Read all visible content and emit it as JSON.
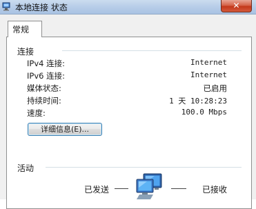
{
  "window": {
    "title": "本地连接 状态",
    "close_glyph": "✕"
  },
  "tabs": [
    {
      "label": "常规"
    }
  ],
  "connection": {
    "heading": "连接",
    "rows": [
      {
        "label": "IPv4 连接:",
        "value": "Internet"
      },
      {
        "label": "IPv6 连接:",
        "value": "Internet"
      },
      {
        "label": "媒体状态:",
        "value": "已启用"
      },
      {
        "label": "持续时间:",
        "value": "1 天 10:28:23"
      },
      {
        "label": "速度:",
        "value": "100.0 Mbps"
      }
    ],
    "details_button": "详细信息(E)..."
  },
  "activity": {
    "heading": "活动",
    "sent_label": "已发送",
    "received_label": "已接收"
  },
  "icons": {
    "window_icon": "network-connection-icon",
    "activity_icon": "network-computers-icon"
  },
  "colors": {
    "titlebar": "#b7cde8",
    "close_button": "#c3381a",
    "button_border": "#3c7fb1",
    "separator": "#d5dfe5"
  }
}
